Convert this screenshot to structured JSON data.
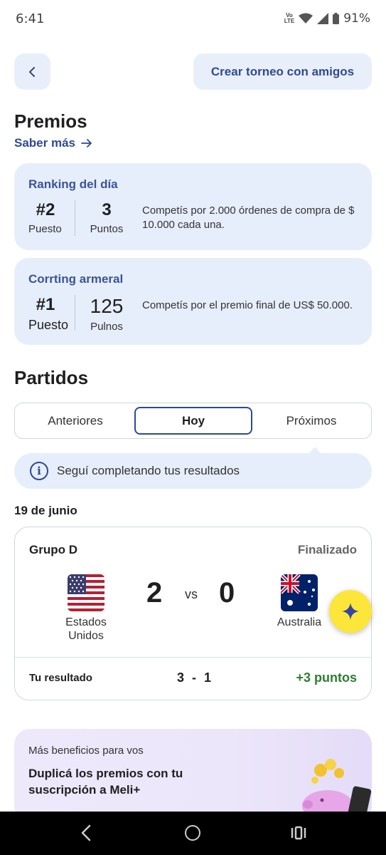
{
  "status_bar": {
    "time": "6:41",
    "volte_label": "Vo LTE",
    "battery": "91%"
  },
  "header": {
    "back_icon": "chevron-left-icon",
    "create_tournament_label": "Crear torneo con amigos"
  },
  "prizes": {
    "title": "Premios",
    "learn_more": "Saber más",
    "cards": [
      {
        "label": "Ranking del día",
        "position": "#2",
        "position_label": "Puesto",
        "points": "3",
        "points_label": "Puntos",
        "description": "Competís por 2.000 órdenes de compra de $ 10.000 cada una."
      },
      {
        "label": "Corrting armeral",
        "position": "#1",
        "position_label": "Puesto",
        "points": "125",
        "points_label": "Pulnos",
        "description": "Competís por el premio final de US$ 50.000."
      }
    ]
  },
  "matches": {
    "title": "Partidos",
    "tabs": {
      "previous": "Anteriores",
      "today": "Hoy",
      "next": "Próximos"
    },
    "info_text": "Seguí completando tus resultados",
    "date": "19 de junio",
    "match": {
      "group": "Grupo D",
      "status": "Finalizado",
      "home_team": "Estados Unidos",
      "home_score": "2",
      "vs": "vs",
      "away_score": "0",
      "away_team": "Australia",
      "your_result_label": "Tu resultado",
      "your_result": "3 - 1",
      "points_earned": "+3 puntos"
    }
  },
  "promo": {
    "kicker": "Más beneficios para vos",
    "title": "Duplicá los premios con tu suscripción a Meli+"
  },
  "colors": {
    "accent": "#2f4a8d",
    "card_bg": "#e6eefb",
    "success": "#2e7d32",
    "fab": "#fde63a"
  }
}
